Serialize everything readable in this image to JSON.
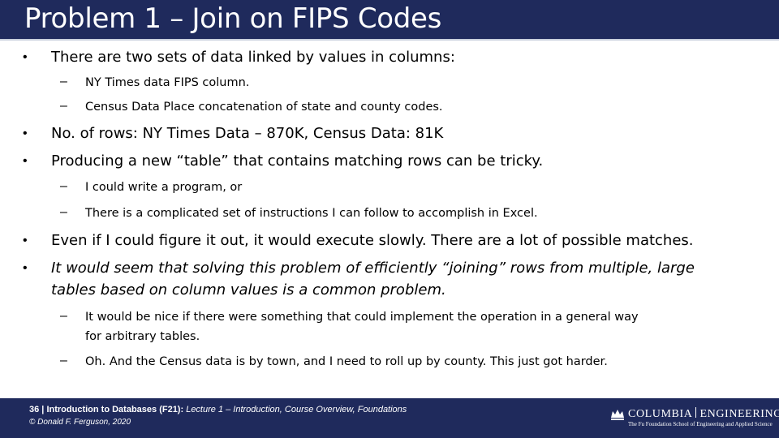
{
  "slide": {
    "title": "Problem 1 – Join on FIPS Codes"
  },
  "content": {
    "b1": "There are two sets of data linked by values in columns:",
    "b1_s1": "NY Times data FIPS column.",
    "b1_s2": "Census Data Place concatenation of state and county codes.",
    "b2": "No. of rows: NY Times Data – 870K, Census Data: 81K",
    "b3": "Producing a new “table” that contains matching rows can be tricky.",
    "b3_s1": "I could write a program, or",
    "b3_s2": "There is a complicated set of instructions I can follow to accomplish in Excel.",
    "b4": "Even if I could figure it out, it would execute slowly. There are a lot of possible matches.",
    "b5_l1": "It would seem that solving this problem of efficiently “joining” rows from multiple, large",
    "b5_l2": "tables based on column values is a common problem.",
    "b5_s1_l1": "It would be nice if there were something that could implement the operation in a general way",
    "b5_s1_l2": "for arbitrary tables.",
    "b5_s2": "Oh. And the Census data is by town, and I need to roll up by county. This just got harder.",
    "bullet_main": "•",
    "bullet_sub": "–"
  },
  "footer": {
    "page": "36",
    "sep": " | ",
    "course": "Introduction to Databases (F21):",
    "lecture": " Lecture 1 – Introduction, Course Overview, Foundations",
    "copyright": "© Donald F. Ferguson, 2020",
    "logo_left": "COLUMBIA",
    "logo_right": "ENGINEERING",
    "logo_sub": "The Fu Foundation School of Engineering and Applied Science"
  },
  "colors": {
    "bar": "#1f2a5c",
    "text": "#000000"
  }
}
